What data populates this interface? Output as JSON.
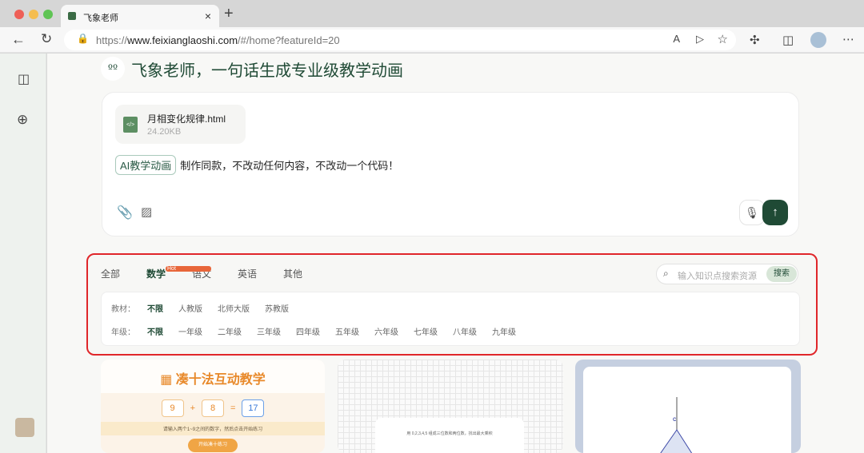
{
  "browser": {
    "tab_title": "飞象老师",
    "url_prefix": "https://",
    "url_host": "www.feixianglaoshi.com",
    "url_path": "/#/home?featureId=20"
  },
  "header": {
    "title": "飞象老师，一句话生成专业级教学动画"
  },
  "composer": {
    "file_name": "月相变化规律.html",
    "file_size": "24.20KB",
    "file_icon": "</>",
    "tag": "AI教学动画",
    "prompt": "制作同款，不改动任何内容，不改动一个代码！"
  },
  "filter": {
    "subjects": [
      "全部",
      "数学",
      "语文",
      "英语",
      "其他"
    ],
    "hot_badge": "Hot",
    "search_placeholder": "输入知识点搜索资源",
    "search_button": "搜索",
    "textbook_label": "教材：",
    "textbooks": [
      "不限",
      "人教版",
      "北师大版",
      "苏教版"
    ],
    "grade_label": "年级：",
    "grades": [
      "不限",
      "一年级",
      "二年级",
      "三年级",
      "四年级",
      "五年级",
      "六年级",
      "七年级",
      "八年级",
      "九年级"
    ]
  },
  "cards": [
    {
      "title": "凑十法互动教学",
      "a": "9",
      "op": "+",
      "b": "8",
      "eq": "=",
      "result": "17",
      "hint": "请输入两个1~9之间的数字，然后点击开始练习",
      "button": "开始凑十练习"
    },
    {
      "question": "用 0,2,3,4,5 组成三位数和两位数，找出最大乘积"
    },
    {
      "label": "C"
    }
  ]
}
